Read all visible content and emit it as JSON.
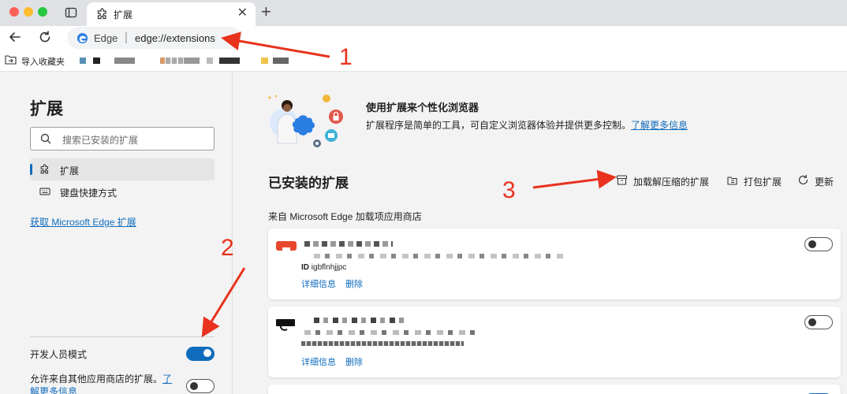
{
  "browser": {
    "tab_title": "扩展",
    "omnibox_edge": "Edge",
    "omnibox_url": "edge://extensions",
    "bookmark_import": "导入收藏夹"
  },
  "sidebar": {
    "title": "扩展",
    "search_placeholder": "搜索已安装的扩展",
    "items": [
      {
        "label": "扩展",
        "icon": "puzzle-icon",
        "active": true
      },
      {
        "label": "键盘快捷方式",
        "icon": "keyboard-icon",
        "active": false
      }
    ],
    "get_extensions_link": "获取 Microsoft Edge 扩展",
    "developer_mode_label": "开发人员模式",
    "developer_mode_on": true,
    "allow_other_stores_label": "允许来自其他应用商店的扩展。",
    "allow_other_stores_link": "了解更多信息",
    "allow_other_stores_on": false
  },
  "main": {
    "hero_title": "使用扩展来个性化浏览器",
    "hero_desc": "扩展程序是简单的工具，可自定义浏览器体验并提供更多控制。",
    "hero_link": "了解更多信息",
    "installed_title": "已安装的扩展",
    "actions": [
      {
        "label": "加载解压缩的扩展",
        "icon": "box-icon"
      },
      {
        "label": "打包扩展",
        "icon": "package-icon"
      },
      {
        "label": "更新",
        "icon": "refresh-icon"
      }
    ],
    "store_label": "来自 Microsoft Edge 加载项应用商店",
    "extensions": [
      {
        "id_prefix": "ID",
        "id": "igbflnhjjpc",
        "details": "详细信息",
        "remove": "删除",
        "enabled": false
      },
      {
        "id_prefix": "ID",
        "id": "",
        "details": "详细信息",
        "remove": "删除",
        "enabled": false
      }
    ]
  },
  "annotations": [
    "1",
    "2",
    "3"
  ],
  "colors": {
    "accent": "#0f6cbd",
    "annotation": "#e8321e"
  }
}
